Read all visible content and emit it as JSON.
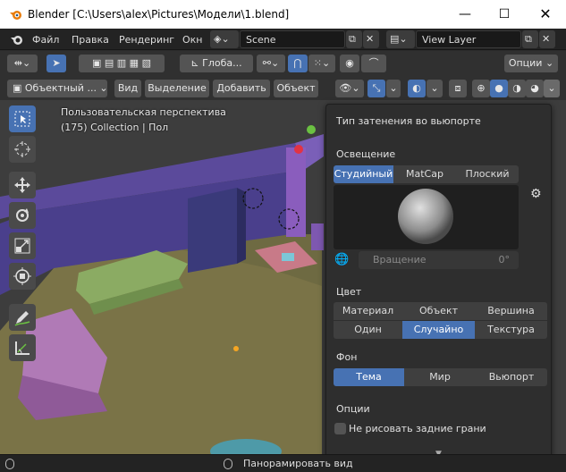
{
  "window": {
    "title": "Blender [C:\\Users\\alex\\Pictures\\Модели\\1.blend]"
  },
  "menu": {
    "file": "Файл",
    "edit": "Правка",
    "render": "Рендеринг",
    "window": "Окн"
  },
  "scene": {
    "name": "Scene"
  },
  "view_layer": {
    "name": "View Layer"
  },
  "toolheader": {
    "orientation": "Глоба...",
    "options": "Опции"
  },
  "header": {
    "mode": "Объектный ...",
    "view": "Вид",
    "select": "Выделение",
    "add": "Добавить",
    "object": "Объект"
  },
  "viewport": {
    "perspective": "Пользовательская перспектива",
    "collection": "(175) Collection | Пол"
  },
  "shading_popup": {
    "title": "Тип затенения во вьюпорте",
    "lighting_label": "Освещение",
    "lighting_options": [
      "Студийный",
      "MatCap",
      "Плоский"
    ],
    "lighting_selected": "Студийный",
    "rotation_label": "Вращение",
    "rotation_value": "0°",
    "color_label": "Цвет",
    "color_options": [
      "Материал",
      "Объект",
      "Вершина",
      "Один",
      "Случайно",
      "Текстура"
    ],
    "color_selected": "Случайно",
    "background_label": "Фон",
    "background_options": [
      "Тема",
      "Мир",
      "Вьюпорт"
    ],
    "background_selected": "Тема",
    "options_label": "Опции",
    "backface_culling_label": "Не рисовать задние грани",
    "backface_culling": false
  },
  "statusbar": {
    "hint": "Панорамировать вид"
  },
  "colors": {
    "accent": "#4772b3",
    "panel": "#2e2e2e",
    "header": "#303030"
  }
}
